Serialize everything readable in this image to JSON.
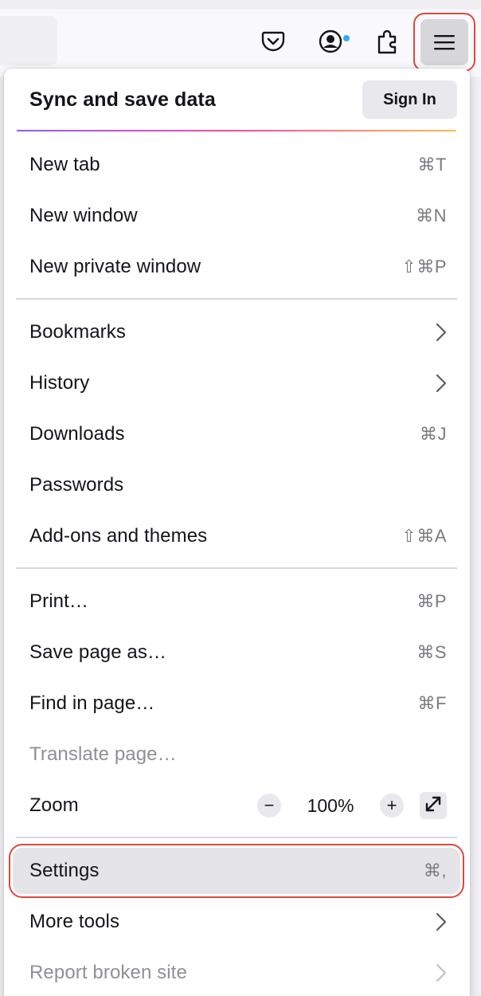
{
  "toolbar": {
    "pocket_icon": "pocket-icon",
    "account_icon": "account-icon",
    "extensions_icon": "puzzle-icon",
    "menu_icon": "hamburger-icon",
    "badge_color": "#36a7f5"
  },
  "menu": {
    "sync_title": "Sync and save data",
    "sign_in_label": "Sign In",
    "sections": [
      [
        {
          "label": "New tab",
          "shortcut": "⌘T"
        },
        {
          "label": "New window",
          "shortcut": "⌘N"
        },
        {
          "label": "New private window",
          "shortcut": "⇧⌘P"
        }
      ],
      [
        {
          "label": "Bookmarks",
          "submenu": true
        },
        {
          "label": "History",
          "submenu": true
        },
        {
          "label": "Downloads",
          "shortcut": "⌘J"
        },
        {
          "label": "Passwords"
        },
        {
          "label": "Add-ons and themes",
          "shortcut": "⇧⌘A"
        }
      ],
      [
        {
          "label": "Print…",
          "shortcut": "⌘P"
        },
        {
          "label": "Save page as…",
          "shortcut": "⌘S"
        },
        {
          "label": "Find in page…",
          "shortcut": "⌘F"
        },
        {
          "label": "Translate page…",
          "disabled": true
        }
      ]
    ],
    "zoom": {
      "label": "Zoom",
      "minus": "−",
      "value": "100%",
      "plus": "+"
    },
    "settings": {
      "label": "Settings",
      "shortcut": "⌘,",
      "highlighted": true
    },
    "more_tools": {
      "label": "More tools",
      "submenu": true
    },
    "report": {
      "label": "Report broken site",
      "submenu": true,
      "disabled": true
    }
  },
  "colors": {
    "highlight_outline": "#e0463a",
    "accent_gradient": [
      "#9059ff",
      "#ff4aa2",
      "#ffbd4f"
    ]
  }
}
